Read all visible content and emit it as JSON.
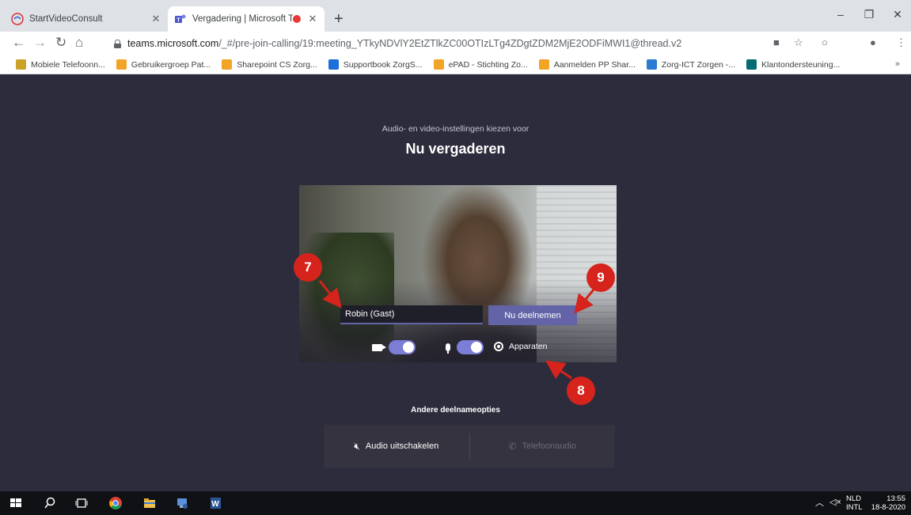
{
  "browser": {
    "tabs": [
      {
        "title": "StartVideoConsult",
        "active": false
      },
      {
        "title": "Vergadering | Microsoft Tean",
        "active": true,
        "recording": true
      }
    ],
    "url_host": "teams.microsoft.com",
    "url_path": "/_#/pre-join-calling/19:meeting_YTkyNDVlY2EtZTlkZC00OTIzLTg4ZDgtZDM2MjE2ODFiMWI1@thread.v2",
    "bookmarks": [
      {
        "label": "Mobiele Telefoonn...",
        "color": "#c9a227"
      },
      {
        "label": "Gebruikergroep Pat...",
        "color": "#f2a427"
      },
      {
        "label": "Sharepoint CS Zorg...",
        "color": "#f2a427"
      },
      {
        "label": "Supportbook ZorgS...",
        "color": "#1e6fd9"
      },
      {
        "label": "ePAD - Stichting Zo...",
        "color": "#f2a427"
      },
      {
        "label": "Aanmelden PP Shar...",
        "color": "#f2a427"
      },
      {
        "label": "Zorg-ICT Zorgen -...",
        "color": "#2a7bd1"
      },
      {
        "label": "Klantondersteuning...",
        "color": "#036c70"
      }
    ]
  },
  "prejoin": {
    "subtitle": "Audio- en video-instellingen kiezen voor",
    "title": "Nu vergaderen",
    "name_value": "Robin (Gast)",
    "join_label": "Nu deelnemen",
    "camera_on": true,
    "mic_on": true,
    "devices_label": "Apparaten",
    "other_options_label": "Andere deelnameopties",
    "audio_off_label": "Audio uitschakelen",
    "phone_audio_label": "Telefoonaudio"
  },
  "annotations": {
    "badge_7": "7",
    "badge_8": "8",
    "badge_9": "9"
  },
  "taskbar": {
    "lang_top": "NLD",
    "lang_bottom": "INTL",
    "time": "13:55",
    "date": "18-8-2020"
  }
}
